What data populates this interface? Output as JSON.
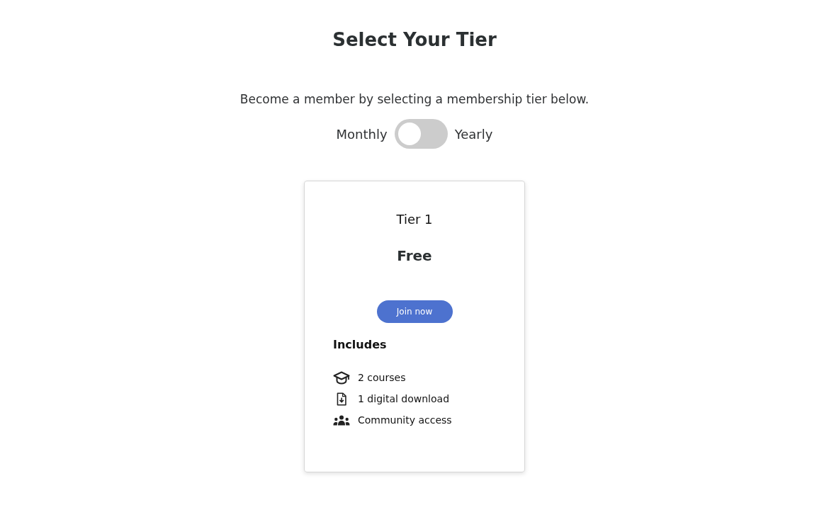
{
  "page": {
    "title": "Select Your Tier",
    "subtitle": "Become a member by selecting a membership tier below."
  },
  "billing_toggle": {
    "left_label": "Monthly",
    "right_label": "Yearly",
    "on": false
  },
  "tiers": [
    {
      "name": "Tier 1",
      "price": "Free",
      "button": "Join now",
      "includes_heading": "Includes",
      "features": [
        {
          "kind": "courses",
          "label": "2 courses"
        },
        {
          "kind": "download",
          "label": "1 digital download"
        },
        {
          "kind": "community",
          "label": "Community access"
        }
      ]
    }
  ]
}
